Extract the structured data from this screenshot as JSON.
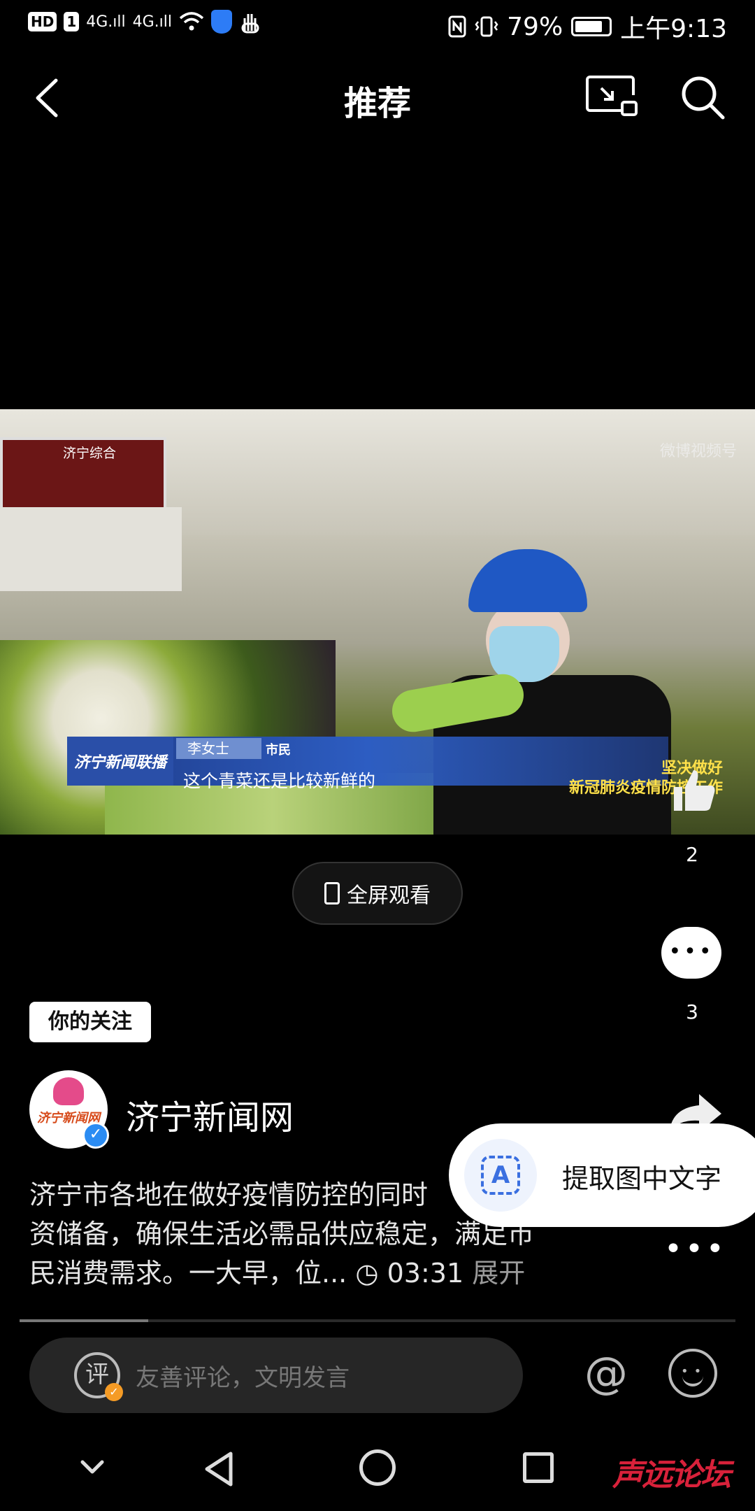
{
  "status_bar": {
    "hd_badge": "HD",
    "sim_badge": "1",
    "signal1": "4G.ıll",
    "signal2": "4G.ıll",
    "battery_percent": "79%",
    "battery_level": 0.79,
    "time": "上午9:13"
  },
  "header": {
    "title": "推荐",
    "back_icon": "back-arrow-icon",
    "cast_icon": "screen-cast-icon",
    "search_icon": "search-icon"
  },
  "video": {
    "channel_logo": "济宁综合",
    "corner_watermark": "微博视频号",
    "program_name": "济宁新闻联播",
    "speaker_name": "李女士",
    "speaker_role": "市民",
    "subtitle": "这个青菜还是比较新鲜的",
    "slogan_line1": "坚决做好",
    "slogan_line2": "新冠肺炎疫情防控工作"
  },
  "fullscreen_button": {
    "label": "全屏观看",
    "icon": "phone-rotate-icon"
  },
  "rail": {
    "like_count": "2",
    "comment_count": "3"
  },
  "author": {
    "follow_badge": "你的关注",
    "name": "济宁新闻网",
    "avatar_text": "济宁新闻网",
    "verified_mark": "✓"
  },
  "description": {
    "text": "济宁市各地在做好疫情防控的同时，…资储备，确保生活必需品供应稳定，满足市民消费需求。一大早，位...",
    "line1": "济宁市各地在做好疫情防控的同时",
    "line2": "资储备，确保生活必需品供应稳定，满足市",
    "line3": "民消费需求。一大早，位...",
    "duration": "03:31",
    "expand": "展开"
  },
  "ocr_popup": {
    "label": "提取图中文字",
    "icon_letter": "A"
  },
  "progress": {
    "played_fraction": 0.18
  },
  "comment_bar": {
    "placeholder": "友善评论，文明发言",
    "ping_char": "评",
    "at_symbol": "@"
  },
  "site_watermark": "声远论坛"
}
